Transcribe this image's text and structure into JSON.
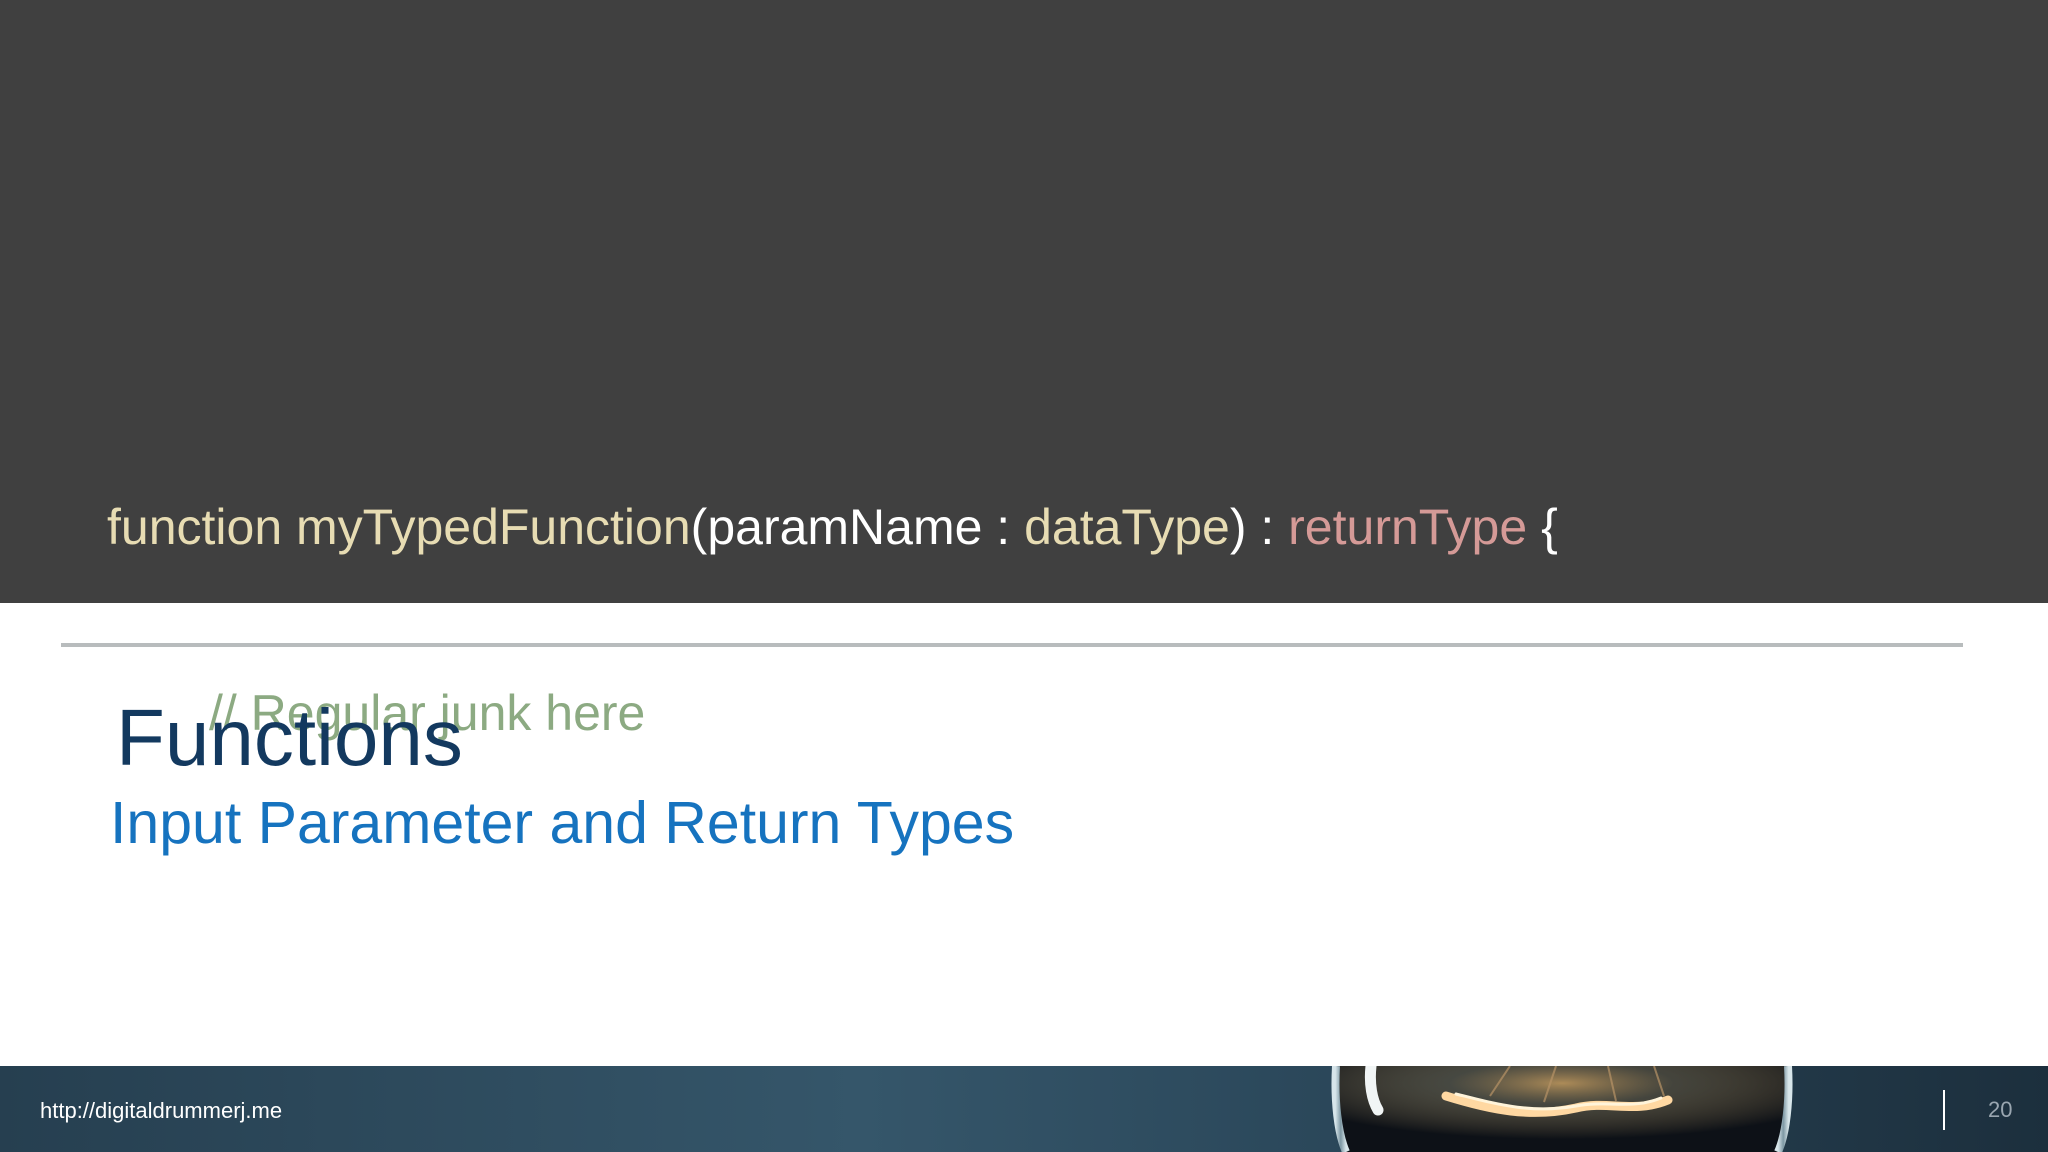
{
  "code": {
    "line1": {
      "keyword": "function",
      "space1": " ",
      "function_name": "myTypedFunction",
      "open_paren_param": "(paramName : ",
      "param_type": "dataType",
      "close_paren_colon": ") : ",
      "return_type": "returnType",
      "space_brace": " {"
    },
    "line2": {
      "comment": "// Regular junk here"
    },
    "line3": {
      "closing_brace": "}"
    }
  },
  "slide": {
    "title": "Functions",
    "subtitle": "Input Parameter and Return Types"
  },
  "footer": {
    "url": "http://digitaldrummerj.me",
    "page_number": "20"
  },
  "colors": {
    "code_background": "#404040",
    "keyword": "#e7dcb3",
    "return_type": "#d59a97",
    "comment": "#8caa82",
    "title": "#13395f",
    "subtitle": "#1673bf",
    "divider": "#b8bcbd"
  },
  "icons": {
    "footer_image": "lightbulb-image"
  }
}
